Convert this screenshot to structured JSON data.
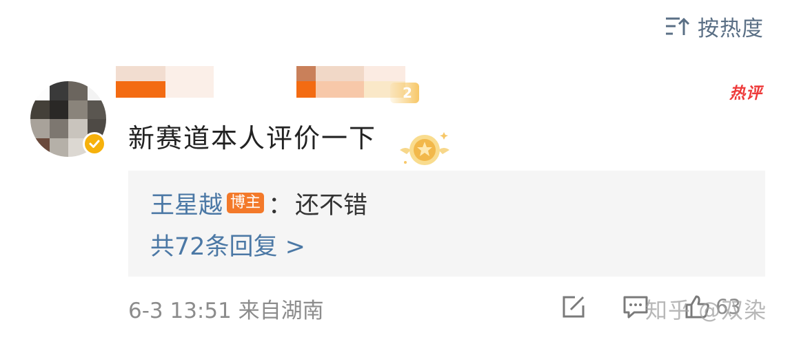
{
  "sort": {
    "label": "按热度",
    "icon": "sort-icon"
  },
  "comment": {
    "rank_badge": "2",
    "hot_badge": "热评",
    "text": "新赛道本人评价一下",
    "avatar_verified_icon": "check-icon"
  },
  "reply": {
    "author": "王星越",
    "tag": "博主",
    "colon": "：",
    "content": "还不错",
    "count_label": "共72条回复 >"
  },
  "footer": {
    "meta": "6-3 13:51 来自湖南",
    "like_count": "63",
    "icons": [
      "share-icon",
      "comment-icon",
      "like-icon"
    ]
  },
  "watermark": "知乎 @双染",
  "colors": {
    "link_blue": "#4b78a5",
    "hot_red": "#ee3a3a",
    "blogger_orange": "#f3792a",
    "verified_gold": "#f6b10b",
    "reply_bg": "#f5f5f5"
  }
}
